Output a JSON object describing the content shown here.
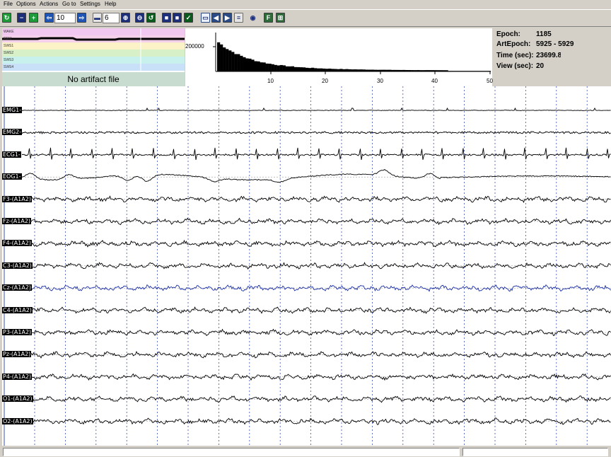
{
  "menu": [
    "File",
    "Options",
    "Actions",
    "Go to",
    "Settings",
    "Help"
  ],
  "toolbar": {
    "epochs_per_page": "10",
    "scale": "6"
  },
  "hypnogram": {
    "stages": [
      "WAKE",
      "REM",
      "SWS1",
      "SWS2",
      "SWS3",
      "SWS4"
    ],
    "stage_colors": [
      "#f0c8f0",
      "#f5d0ea",
      "#fbf2c8",
      "#d8f0c8",
      "#c8f0ec",
      "#c8e0f8"
    ],
    "artifact_label": "No artifact file"
  },
  "histogram": {
    "y_tick": "200000",
    "x_ticks": [
      "10",
      "20",
      "30",
      "40",
      "50"
    ]
  },
  "info": {
    "epoch_label": "Epoch:",
    "epoch_value": "1185",
    "artepoch_label": "ArtEpoch:",
    "artepoch_value": "5925 - 5929",
    "time_label": "Time (sec):",
    "time_value": "23699.8",
    "view_label": "View (sec):",
    "view_value": "20"
  },
  "channels": [
    {
      "label": "EMG1-",
      "kind": "emg",
      "color": "#000000"
    },
    {
      "label": "EMG2-",
      "kind": "emg2",
      "color": "#000000"
    },
    {
      "label": "ECG1-",
      "kind": "ecg",
      "color": "#000000"
    },
    {
      "label": "EOG1-",
      "kind": "eog",
      "color": "#000000"
    },
    {
      "label": "F3-(A1A2)",
      "kind": "eeg",
      "color": "#000000"
    },
    {
      "label": "Fz-(A1A2)",
      "kind": "eeg",
      "color": "#000000"
    },
    {
      "label": "F4-(A1A2)",
      "kind": "eeg",
      "color": "#000000"
    },
    {
      "label": "C3-(A1A2)",
      "kind": "eeg",
      "color": "#000000"
    },
    {
      "label": "Cz-(A1A2)",
      "kind": "eeg",
      "color": "#1a2ea8"
    },
    {
      "label": "C4-(A1A2)",
      "kind": "eeg",
      "color": "#000000"
    },
    {
      "label": "P3-(A1A2)",
      "kind": "eeg",
      "color": "#000000"
    },
    {
      "label": "Pz-(A1A2)",
      "kind": "eeg",
      "color": "#000000"
    },
    {
      "label": "P4-(A1A2)",
      "kind": "eeg",
      "color": "#000000"
    },
    {
      "label": "O1-(A1A2)",
      "kind": "eeg",
      "color": "#000000"
    },
    {
      "label": "O2-(A1A2)",
      "kind": "eeg",
      "color": "#000000"
    }
  ]
}
